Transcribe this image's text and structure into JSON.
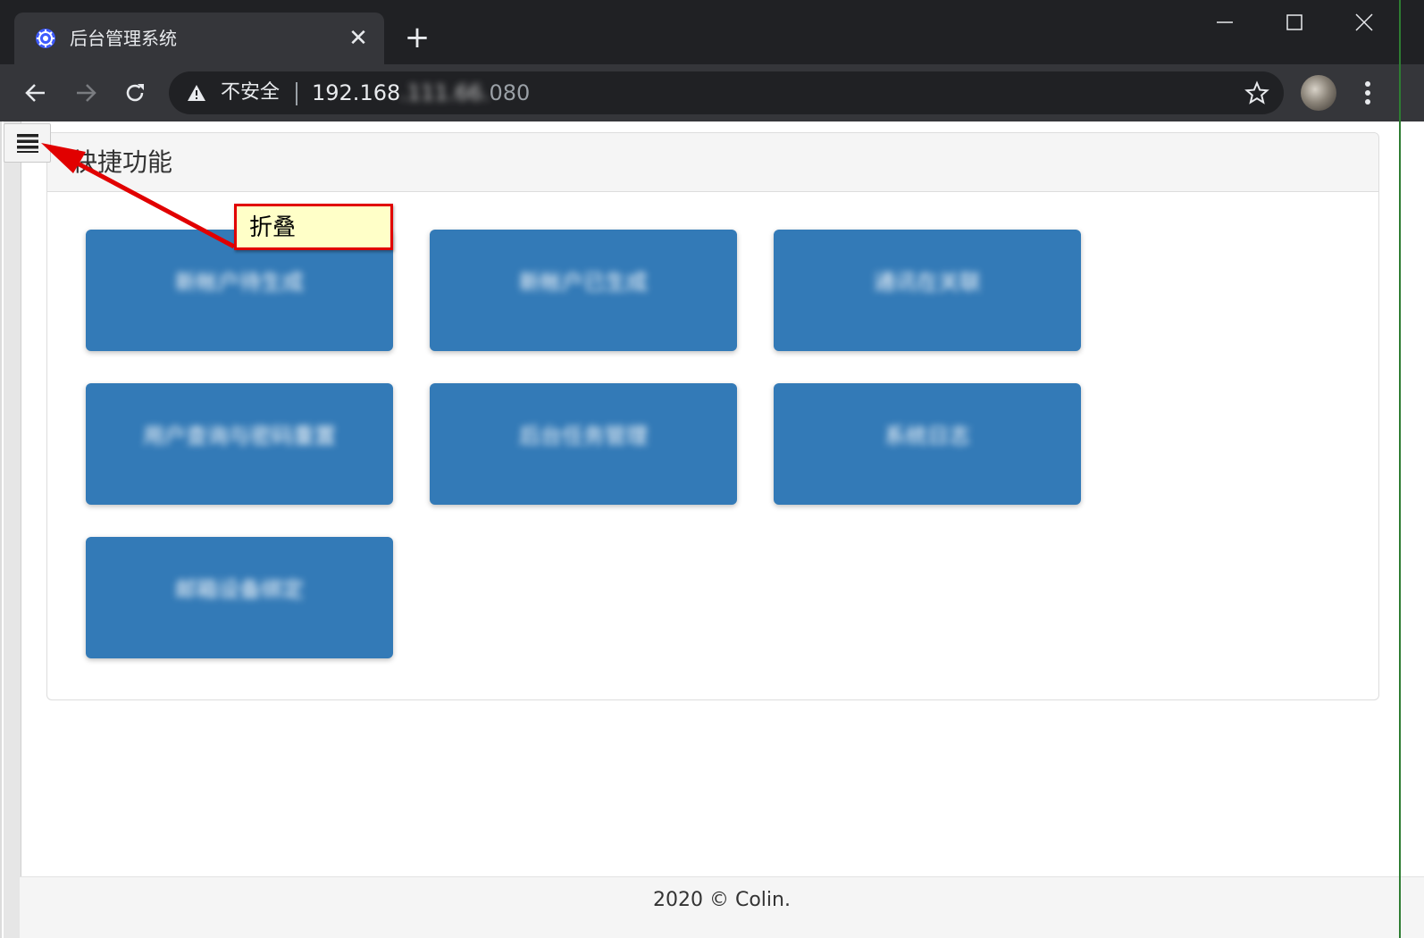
{
  "browser": {
    "tab_title": "后台管理系统",
    "tab_close": "✕",
    "new_tab": "+",
    "security_label": "不安全",
    "url_visible": "192.168",
    "url_blurred": ".111.66.",
    "url_tail": "080"
  },
  "page": {
    "panel_title": "快捷功能",
    "tiles": [
      {
        "label": "新帐户待生成"
      },
      {
        "label": "新帐户已生成"
      },
      {
        "label": "通讯在关联"
      },
      {
        "label": "用户查询与密码重置"
      },
      {
        "label": "后台任务管理"
      },
      {
        "label": "系统日志"
      },
      {
        "label": "邮箱设备绑定"
      }
    ],
    "footer": "2020 © Colin."
  },
  "annotation": {
    "callout_text": "折叠",
    "color": "#e10000",
    "fill": "#ffffc8"
  },
  "colors": {
    "tile": "#337ab7",
    "chrome_dark": "#202124",
    "chrome_toolbar": "#35363a"
  }
}
